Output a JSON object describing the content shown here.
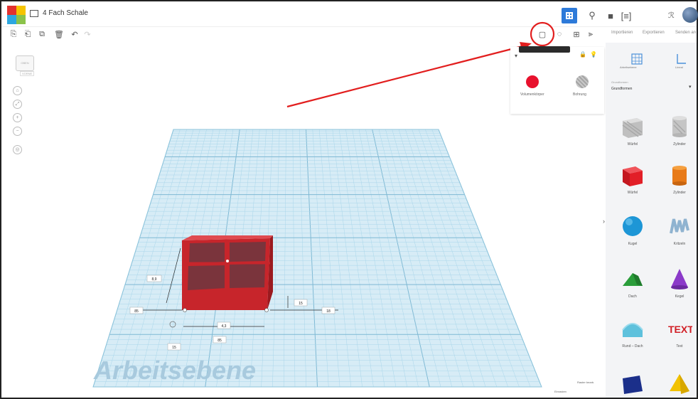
{
  "app": {
    "title": "4 Fach Schale"
  },
  "topbar": {
    "user_line1": "",
    "user_line2": ""
  },
  "inspector": {
    "tooltip": "",
    "solid_label": "Volumenkörper",
    "hole_label": "Bohrung"
  },
  "right_panel": {
    "tabs": [
      "Importieren",
      "Exportieren",
      "Senden an"
    ],
    "tools": [
      {
        "label": "Arbeitsebene"
      },
      {
        "label": "Lineal"
      }
    ],
    "library_label": "Grundformen",
    "library_value": "Grundformen",
    "shapes": [
      {
        "label": "Würfel"
      },
      {
        "label": "Zylinder"
      },
      {
        "label": "Würfel"
      },
      {
        "label": "Zylinder"
      },
      {
        "label": "Kugel"
      },
      {
        "label": "Kritzeln"
      },
      {
        "label": "Dach"
      },
      {
        "label": "Kegel"
      },
      {
        "label": "Rund – Dach"
      },
      {
        "label": "Text"
      }
    ]
  },
  "workplane": {
    "label": "Arbeitsebene",
    "dims": [
      "8,9",
      "85",
      "15",
      "4,3",
      "85",
      "18"
    ]
  },
  "bottom": {
    "edit_grid": "Raster bearb.",
    "snap": "Einrasten"
  },
  "colors": {
    "accent": "#2d7ad9",
    "shape_red": "#d42127",
    "grid": "#a9d6ea",
    "annotation": "#e21e1e"
  },
  "icons": [
    "logo-icon",
    "list-icon",
    "copy-icon",
    "paste-icon",
    "duplicate-icon",
    "delete-icon",
    "undo-icon",
    "redo-icon",
    "group-icon",
    "align-icon",
    "mirror-icon",
    "lock-icon",
    "light-bulb-icon",
    "home-icon",
    "zoom-in-icon",
    "zoom-out-icon",
    "fit-icon"
  ]
}
